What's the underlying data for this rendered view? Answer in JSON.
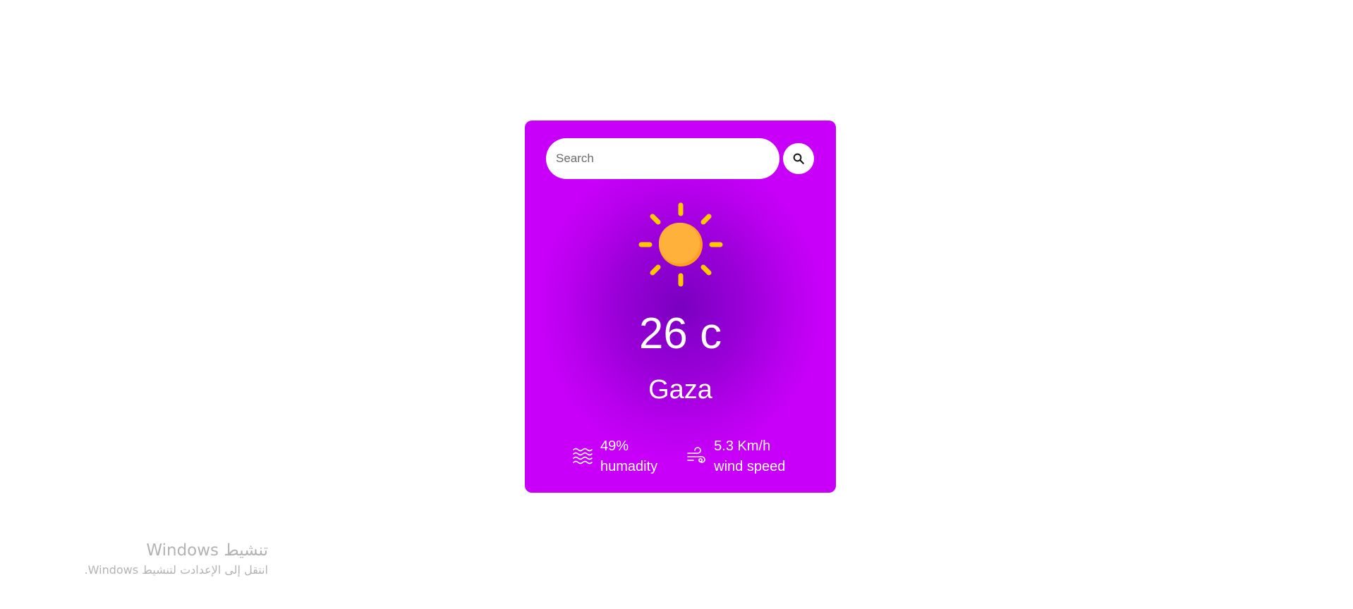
{
  "search": {
    "placeholder": "Search",
    "button_icon": "search-icon"
  },
  "weather": {
    "icon": "sun-icon",
    "temperature": "26 c",
    "city": "Gaza",
    "humidity": {
      "icon": "humidity-waves-icon",
      "value": "49%",
      "label": "humadity"
    },
    "wind": {
      "icon": "wind-icon",
      "value": "5.3 Km/h",
      "label": "wind speed"
    }
  },
  "watermark": {
    "title": "تنشيط Windows",
    "subtitle": "انتقل إلى الإعدادت لتنشيط Windows."
  },
  "colors": {
    "card_center": "#7a00c0",
    "card_edge": "#c800fa",
    "sun": "#ffb13b",
    "sun_rays": "#ffc800",
    "watermark_text": "#b3b3b3"
  }
}
